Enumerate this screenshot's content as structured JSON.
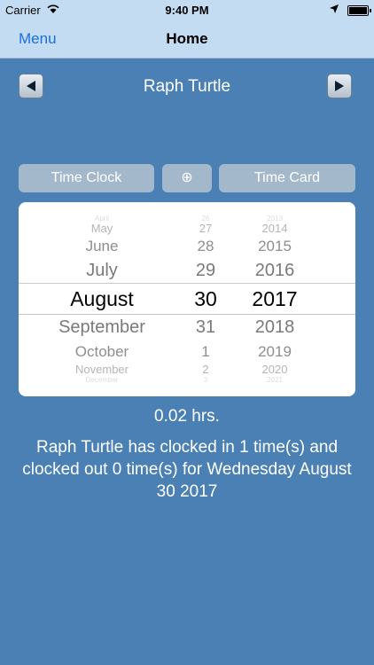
{
  "status": {
    "carrier": "Carrier",
    "time": "9:40 PM"
  },
  "nav": {
    "menu": "Menu",
    "title": "Home"
  },
  "person": {
    "name": "Raph Turtle"
  },
  "segments": {
    "left": "Time Clock",
    "center": "⊕",
    "right": "Time Card"
  },
  "picker": {
    "months": [
      "April",
      "May",
      "June",
      "July",
      "August",
      "September",
      "October",
      "November",
      "December"
    ],
    "days": [
      "26",
      "27",
      "28",
      "29",
      "30",
      "31",
      "1",
      "2",
      "3"
    ],
    "years": [
      "2013",
      "2014",
      "2015",
      "2016",
      "2017",
      "2018",
      "2019",
      "2020",
      "2021"
    ]
  },
  "hours": "0.02 hrs.",
  "summary": "Raph Turtle has clocked in 1 time(s) and clocked out 0 time(s) for Wednesday August 30 2017"
}
